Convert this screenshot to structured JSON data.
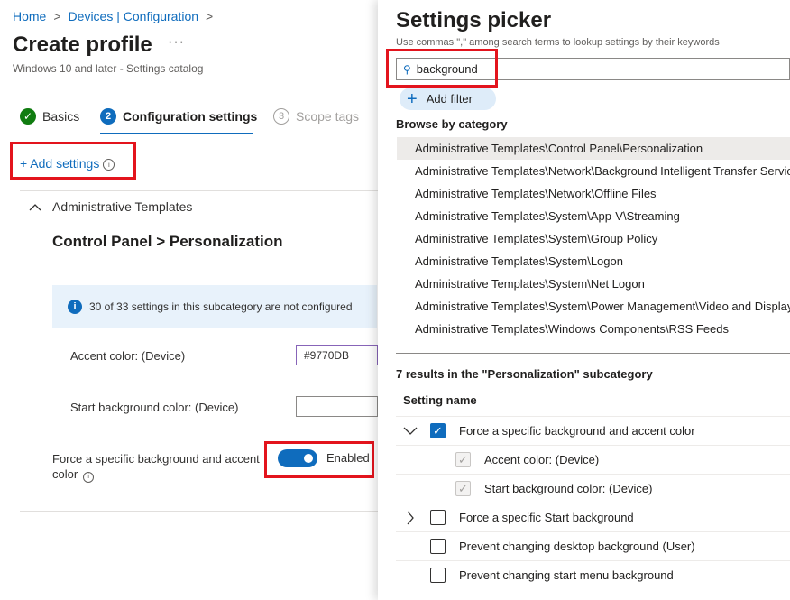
{
  "breadcrumb": {
    "home": "Home",
    "devices": "Devices | Configuration",
    "separator": ">"
  },
  "page": {
    "title": "Create profile",
    "more": "···",
    "subtitle": "Windows 10 and later - Settings catalog"
  },
  "steps": [
    {
      "label": "Basics",
      "marker": "✓"
    },
    {
      "label": "Configuration settings",
      "marker": "2"
    },
    {
      "label": "Scope tags",
      "marker": "3"
    }
  ],
  "add_settings": {
    "label": "+ Add settings",
    "info": "i"
  },
  "group": {
    "chevron": "^",
    "label": "Administrative Templates"
  },
  "subcategory": {
    "heading": "Control Panel > Personalization"
  },
  "info_bar": {
    "icon": "i",
    "text": "30 of 33 settings in this subcategory are not configured"
  },
  "fields": {
    "accent_label": "Accent color: (Device)",
    "accent_value": "#9770DB",
    "start_bg_label": "Start background color: (Device)",
    "start_bg_value": ""
  },
  "force_setting": {
    "label": "Force a specific background and accent color",
    "info": "i",
    "toggle_label": "Enabled",
    "enabled": true
  },
  "picker": {
    "title": "Settings picker",
    "hint": "Use commas \",\" among search terms to lookup settings by their keywords",
    "search_value": "background",
    "add_filter": "Add filter",
    "add_filter_icon": "+",
    "browse_label": "Browse by category",
    "categories": [
      "Administrative Templates\\Control Panel\\Personalization",
      "Administrative Templates\\Network\\Background Intelligent Transfer Service",
      "Administrative Templates\\Network\\Offline Files",
      "Administrative Templates\\System\\App-V\\Streaming",
      "Administrative Templates\\System\\Group Policy",
      "Administrative Templates\\System\\Logon",
      "Administrative Templates\\System\\Net Logon",
      "Administrative Templates\\System\\Power Management\\Video and Display Settings",
      "Administrative Templates\\Windows Components\\RSS Feeds"
    ],
    "results_label": "7 results in the \"Personalization\" subcategory",
    "column_header": "Setting name",
    "results": [
      {
        "label": "Force a specific background and accent color",
        "checked": true,
        "expander": "﹀"
      },
      {
        "label": "Accent color: (Device)",
        "checked": true,
        "child": true
      },
      {
        "label": "Start background color: (Device)",
        "checked": true,
        "child": true
      },
      {
        "label": "Force a specific Start background",
        "checked": false,
        "expander": "›"
      },
      {
        "label": "Prevent changing desktop background (User)",
        "checked": false
      },
      {
        "label": "Prevent changing start menu background",
        "checked": false
      }
    ]
  },
  "colors": {
    "accent": "#0f6cbd",
    "highlight_box": "#e3141d",
    "success": "#107c10"
  }
}
